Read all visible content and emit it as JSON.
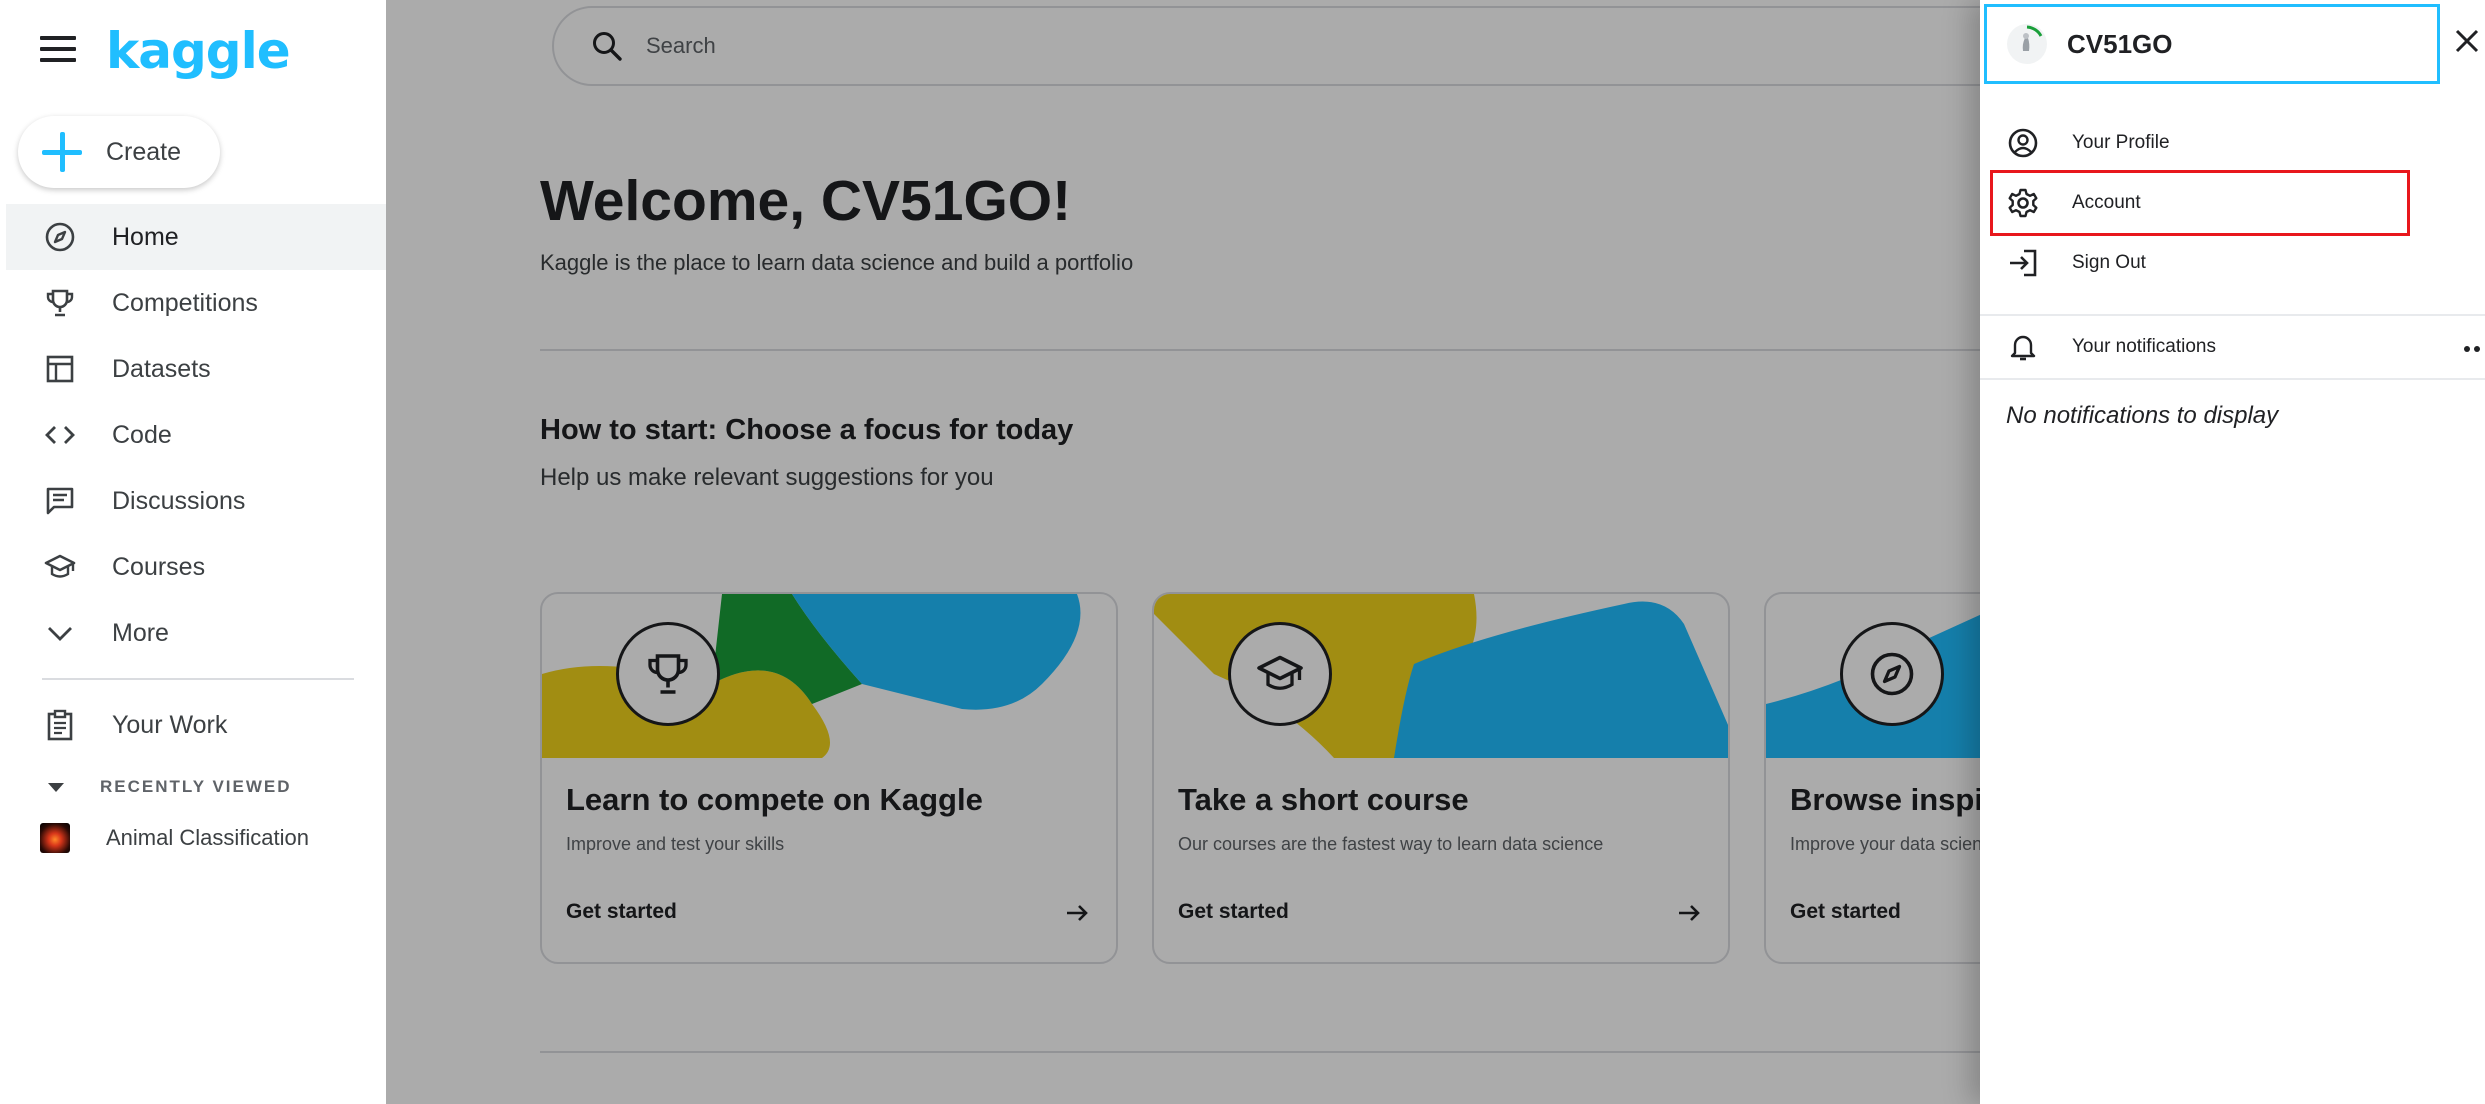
{
  "brand": {
    "logo_text": "kaggle",
    "accent_color": "#20beff"
  },
  "sidebar": {
    "create_label": "Create",
    "nav": [
      {
        "label": "Home",
        "icon": "compass-icon",
        "active": true
      },
      {
        "label": "Competitions",
        "icon": "trophy-icon"
      },
      {
        "label": "Datasets",
        "icon": "table-icon"
      },
      {
        "label": "Code",
        "icon": "code-icon"
      },
      {
        "label": "Discussions",
        "icon": "comment-icon"
      },
      {
        "label": "Courses",
        "icon": "graduation-cap-icon"
      },
      {
        "label": "More",
        "icon": "chevron-down-icon"
      }
    ],
    "your_work_label": "Your Work",
    "recently_viewed_label": "RECENTLY VIEWED",
    "recent_items": [
      {
        "label": "Animal Classification"
      }
    ]
  },
  "search": {
    "placeholder": "Search"
  },
  "main": {
    "welcome_title": "Welcome, CV51GO!",
    "welcome_sub": "Kaggle is the place to learn data science and build a portfolio",
    "howto_title": "How to start: Choose a focus for today",
    "howto_sub": "Help us make relevant suggestions for you",
    "cards": [
      {
        "title": "Learn to compete on Kaggle",
        "subtitle": "Improve and test your skills",
        "cta": "Get started",
        "icon": "trophy-icon"
      },
      {
        "title": "Take a short course",
        "subtitle": "Our courses are the fastest way to learn data science",
        "cta": "Get started",
        "icon": "graduation-cap-icon"
      },
      {
        "title": "Browse inspiring code",
        "subtitle": "Improve your data science skills",
        "cta": "Get started",
        "icon": "compass-icon"
      }
    ]
  },
  "panel": {
    "username": "CV51GO",
    "items": [
      {
        "label": "Your Profile",
        "icon": "user-circle-icon"
      },
      {
        "label": "Account",
        "icon": "gear-icon"
      },
      {
        "label": "Sign Out",
        "icon": "sign-out-icon"
      }
    ],
    "notifications_label": "Your notifications",
    "no_notifications": "No notifications to display"
  }
}
